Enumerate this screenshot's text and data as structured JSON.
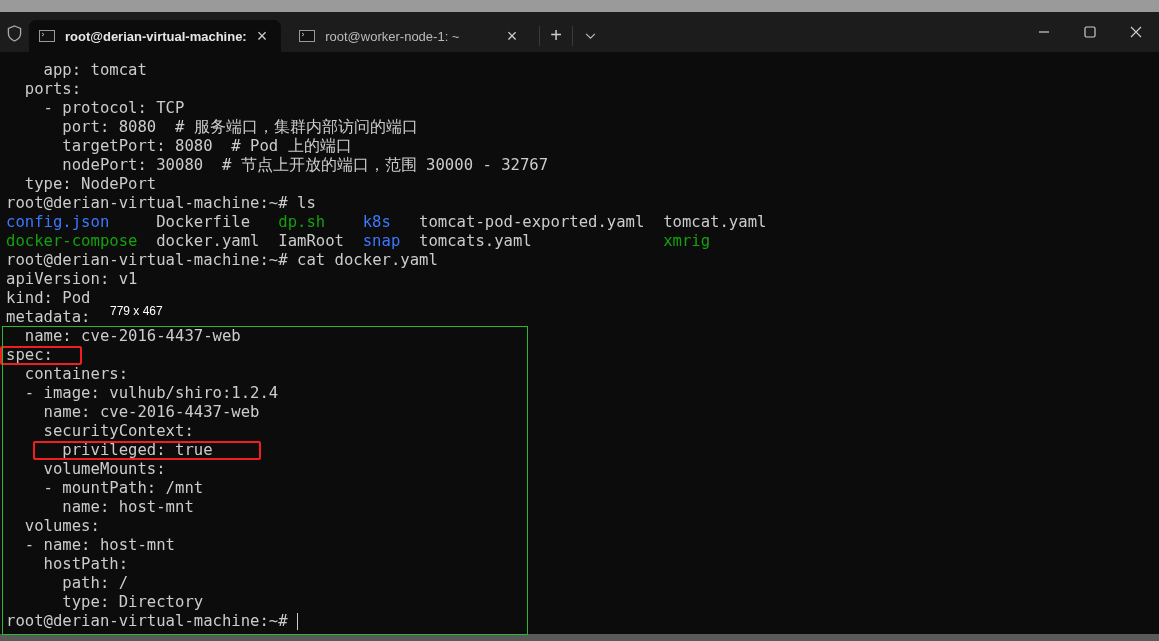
{
  "tabs": [
    {
      "title": "root@derian-virtual-machine:",
      "selected": true,
      "close": "×"
    },
    {
      "title": "root@worker-node-1: ~",
      "selected": false,
      "close": "×"
    }
  ],
  "new_tab": "+",
  "terminal": {
    "lines": [
      {
        "kind": "text",
        "text": "    app: tomcat"
      },
      {
        "kind": "text",
        "text": "  ports:"
      },
      {
        "kind": "text",
        "text": "    - protocol: TCP"
      },
      {
        "kind": "text",
        "text": "      port: 8080  # 服务端口，集群内部访问的端口"
      },
      {
        "kind": "text",
        "text": "      targetPort: 8080  # Pod 上的端口"
      },
      {
        "kind": "text",
        "text": "      nodePort: 30080  # 节点上开放的端口，范围 30000 - 32767"
      },
      {
        "kind": "text",
        "text": "  type: NodePort"
      },
      {
        "kind": "text",
        "text": "root@derian-virtual-machine:~# ls"
      },
      {
        "kind": "ls",
        "entries": [
          {
            "name": "config.json",
            "color": "#3b78ff"
          },
          {
            "name": "Dockerfile",
            "color": "#cccccc"
          },
          {
            "name": "dp.sh",
            "color": "#13a10e"
          },
          {
            "name": "k8s",
            "color": "#3b78ff"
          },
          {
            "name": "tomcat-pod-exported.yaml",
            "color": "#cccccc"
          },
          {
            "name": "tomcat.yaml",
            "color": "#cccccc"
          }
        ]
      },
      {
        "kind": "ls",
        "entries": [
          {
            "name": "docker-compose",
            "color": "#13a10e"
          },
          {
            "name": "docker.yaml",
            "color": "#cccccc"
          },
          {
            "name": "IamRoot",
            "color": "#cccccc"
          },
          {
            "name": "snap",
            "color": "#3b78ff"
          },
          {
            "name": "tomcats.yaml",
            "color": "#cccccc"
          },
          {
            "name": "xmrig",
            "color": "#13a10e"
          }
        ]
      },
      {
        "kind": "text",
        "text": "root@derian-virtual-machine:~# cat docker.yaml"
      },
      {
        "kind": "text",
        "text": "apiVersion: v1"
      },
      {
        "kind": "text",
        "text": "kind: Pod"
      },
      {
        "kind": "text",
        "text": "metadata:"
      },
      {
        "kind": "text",
        "text": "  name: cve-2016-4437-web"
      },
      {
        "kind": "text",
        "text": "spec:",
        "highlighted": true
      },
      {
        "kind": "text",
        "text": "  containers:"
      },
      {
        "kind": "text",
        "text": "  - image: vulhub/shiro:1.2.4"
      },
      {
        "kind": "text",
        "text": "    name: cve-2016-4437-web"
      },
      {
        "kind": "text",
        "text": "    securityContext:"
      },
      {
        "kind": "text",
        "text": "      privileged: true",
        "highlighted": true
      },
      {
        "kind": "text",
        "text": "    volumeMounts:"
      },
      {
        "kind": "text",
        "text": "    - mountPath: /mnt"
      },
      {
        "kind": "text",
        "text": "      name: host-mnt"
      },
      {
        "kind": "text",
        "text": "  volumes:"
      },
      {
        "kind": "text",
        "text": "  - name: host-mnt"
      },
      {
        "kind": "text",
        "text": "    hostPath:"
      },
      {
        "kind": "text",
        "text": "      path: /"
      },
      {
        "kind": "text",
        "text": "      type: Directory"
      },
      {
        "kind": "prompt",
        "text": "root@derian-virtual-machine:~# "
      }
    ]
  },
  "selection": {
    "label": "779 x 467"
  }
}
